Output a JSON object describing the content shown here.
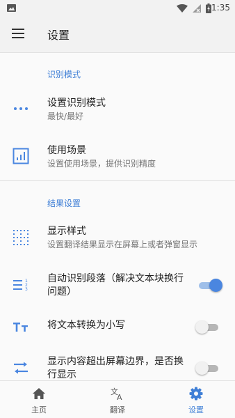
{
  "status_bar": {
    "time": "1:35"
  },
  "app_bar": {
    "title": "设置"
  },
  "sections": {
    "recognition": {
      "header": "识别模式"
    },
    "result": {
      "header": "结果设置"
    }
  },
  "prefs": {
    "mode": {
      "title": "设置识别模式",
      "summary": "最快/最好",
      "icon": "more-horiz-icon"
    },
    "scene": {
      "title": "使用场景",
      "summary": "设置使用场景，提供识别精度",
      "icon": "chart-box-icon"
    },
    "style": {
      "title": "显示样式",
      "summary": "设置翻译结果显示在屏幕上或者弹窗显示",
      "icon": "dot-grid-icon"
    },
    "auto_paragraph": {
      "title": "自动识别段落（解决文本块换行问题）",
      "checked": true,
      "icon": "numbered-list-icon"
    },
    "lowercase": {
      "title": "将文本转换为小写",
      "checked": false,
      "icon": "text-case-icon"
    },
    "wrap": {
      "title": "显示内容超出屏幕边界，是否换行显示",
      "checked": false,
      "icon": "wrap-arrows-icon"
    }
  },
  "bottom_nav": {
    "items": [
      {
        "label": "主页",
        "icon": "home-icon",
        "active": false
      },
      {
        "label": "翻译",
        "icon": "translate-icon",
        "active": false
      },
      {
        "label": "设置",
        "icon": "gear-icon",
        "active": true
      }
    ]
  },
  "colors": {
    "accent": "#3f7fd6",
    "icon_blue": "#4a86e0",
    "switch_off": "#b6b6b6"
  }
}
